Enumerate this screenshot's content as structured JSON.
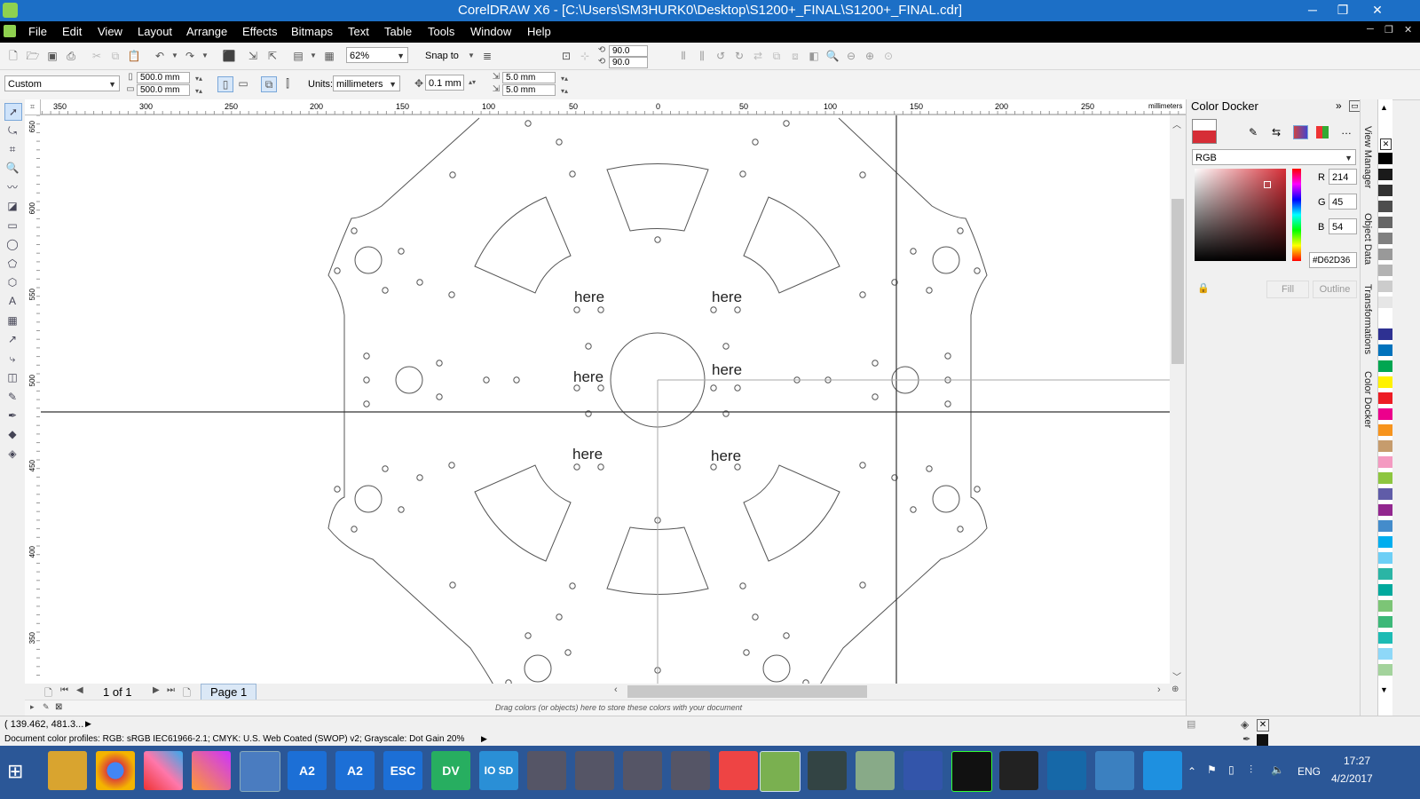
{
  "window": {
    "title": "CorelDRAW X6 - [C:\\Users\\SM3HURK0\\Desktop\\S1200+_FINAL\\S1200+_FINAL.cdr]",
    "minimize": "─",
    "maximize": "❐",
    "close": "✕"
  },
  "menu": [
    "File",
    "Edit",
    "View",
    "Layout",
    "Arrange",
    "Effects",
    "Bitmaps",
    "Text",
    "Table",
    "Tools",
    "Window",
    "Help"
  ],
  "toolbar": {
    "zoom": "62%",
    "snap_to": "Snap to",
    "rotation_1": "90.0",
    "rotation_2": "90.0"
  },
  "property_bar": {
    "page_preset": "Custom",
    "width": "500.0 mm",
    "height": "500.0 mm",
    "units_label": "Units:",
    "units_value": "millimeters",
    "nudge": "0.1 mm",
    "dup_x": "5.0 mm",
    "dup_y": "5.0 mm"
  },
  "rulers": {
    "unit": "millimeters",
    "h_ticks": [
      "350",
      "300",
      "250",
      "200",
      "150",
      "100",
      "50",
      "0",
      "50",
      "100",
      "150",
      "200",
      "250"
    ],
    "v_ticks": [
      "650",
      "600",
      "550",
      "500",
      "450",
      "400",
      "350"
    ]
  },
  "canvas": {
    "labels": [
      "here",
      "here",
      "here",
      "here",
      "here",
      "here"
    ]
  },
  "page_nav": {
    "count": "1 of 1",
    "tab": "Page 1"
  },
  "palette_strip": {
    "hint": "Drag colors (or objects) here to store these colors with your document"
  },
  "status": {
    "coords": "( 139.462, 481.3... ",
    "profiles": "Document color profiles: RGB: sRGB IEC61966-2.1; CMYK: U.S. Web Coated (SWOP) v2; Grayscale: Dot Gain 20%"
  },
  "color_docker": {
    "title": "Color Docker",
    "model": "RGB",
    "r_label": "R",
    "r": "214",
    "g_label": "G",
    "g": "45",
    "b_label": "B",
    "b": "54",
    "hex": "#D62D36",
    "fill": "Fill",
    "outline": "Outline",
    "swatch_color": "#D62D36"
  },
  "docker_tabs": [
    "View Manager",
    "Object Data",
    "Transformations",
    "Color Docker"
  ],
  "palette_colors": [
    "#000000",
    "#1a1a1a",
    "#333333",
    "#4d4d4d",
    "#666666",
    "#808080",
    "#999999",
    "#b3b3b3",
    "#cccccc",
    "#e6e6e6",
    "#ffffff",
    "#2e3192",
    "#0072bc",
    "#00a651",
    "#fff200",
    "#ed1c24",
    "#ec008c",
    "#f7941d",
    "#c69c6d",
    "#f49ac1",
    "#8dc63f",
    "#605ca8",
    "#92278f",
    "#448ccb",
    "#00aeef",
    "#6dcff6",
    "#2bb5a5",
    "#00a99d",
    "#7cc576",
    "#3cb878",
    "#1cbbb4",
    "#8ed8f8",
    "#a3d39c"
  ],
  "taskbar": {
    "apps": [
      "",
      "",
      "",
      "",
      "",
      "A2",
      "A2",
      "ESC",
      "DV",
      "IO SD",
      "",
      "",
      "",
      "",
      "",
      "",
      "",
      "",
      "",
      "",
      "",
      "",
      "",
      "",
      "",
      ""
    ],
    "lang": "ENG",
    "time": "17:27",
    "date": "4/2/2017"
  }
}
